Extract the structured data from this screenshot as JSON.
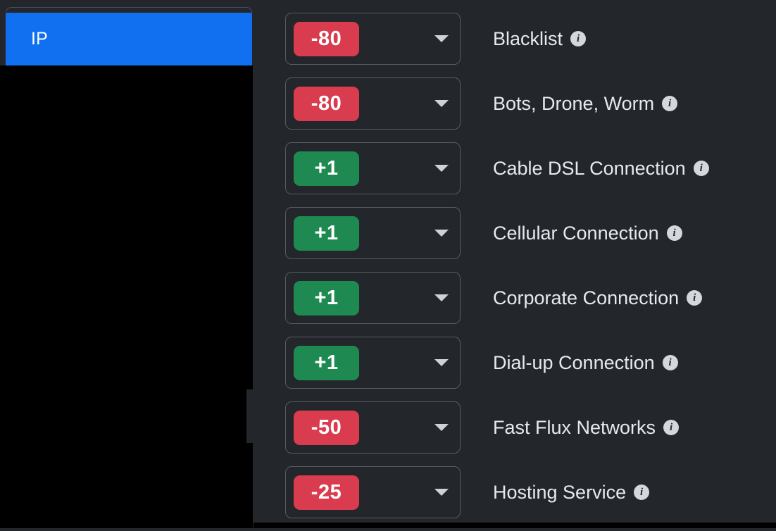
{
  "sidebar": {
    "items": [
      {
        "label": "IP",
        "selected": true
      }
    ]
  },
  "settings": {
    "rows": [
      {
        "score": "-80",
        "sign": "neg",
        "label": "Blacklist",
        "info": "info-icon"
      },
      {
        "score": "-80",
        "sign": "neg",
        "label": "Bots, Drone, Worm",
        "info": "info-icon"
      },
      {
        "score": "+1",
        "sign": "pos",
        "label": "Cable DSL Connection",
        "info": "info-icon"
      },
      {
        "score": "+1",
        "sign": "pos",
        "label": "Cellular Connection",
        "info": "info-icon"
      },
      {
        "score": "+1",
        "sign": "pos",
        "label": "Corporate Connection",
        "info": "info-icon"
      },
      {
        "score": "+1",
        "sign": "pos",
        "label": "Dial-up Connection",
        "info": "info-icon"
      },
      {
        "score": "-50",
        "sign": "neg",
        "label": "Fast Flux Networks",
        "info": "info-icon"
      },
      {
        "score": "-25",
        "sign": "neg",
        "label": "Hosting Service",
        "info": "info-icon"
      }
    ],
    "info_glyph": "i",
    "caret_icon": "chevron-down-icon"
  },
  "colors": {
    "background": "#23262b",
    "panel_black": "#000000",
    "accent_blue": "#1070f0",
    "negative_red": "#d93c4e",
    "positive_green": "#1e8a52",
    "border": "#565c64",
    "text": "#e6e9ed"
  }
}
